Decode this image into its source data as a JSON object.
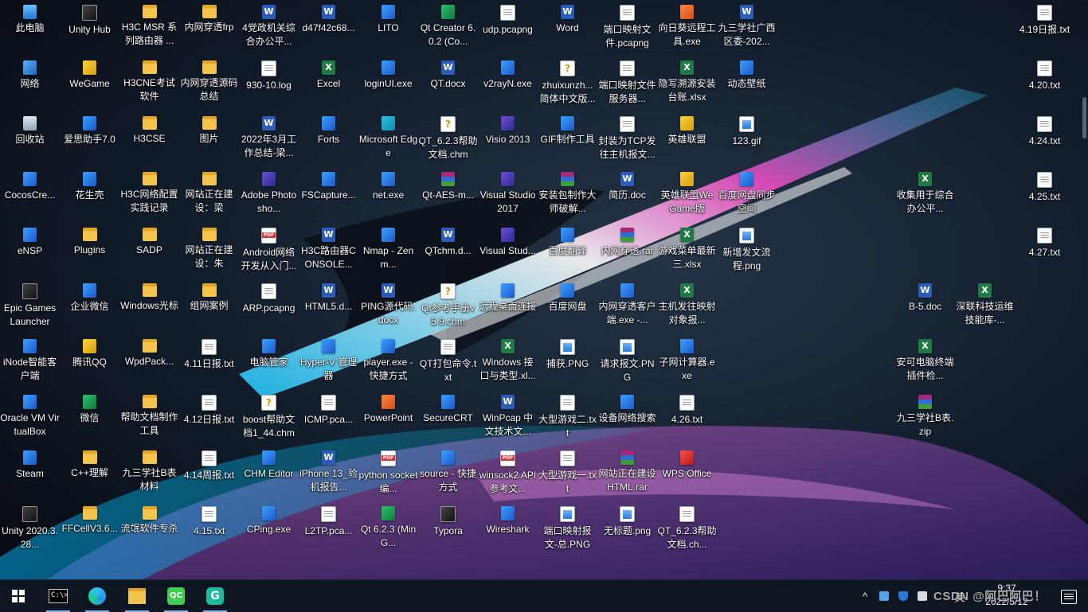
{
  "desktop": {
    "icons": [
      {
        "label": "此电脑",
        "icon": "pc-icon"
      },
      {
        "label": "Unity Hub",
        "icon": "unity-hub-icon"
      },
      {
        "label": "H3C MSR 系列路由器 ...",
        "icon": "folder-icon"
      },
      {
        "label": "内网穿透frp",
        "icon": "folder-icon"
      },
      {
        "label": "4党政机关综合办公平...",
        "icon": "word-icon"
      },
      {
        "label": "d47f42c68...",
        "icon": "word-icon"
      },
      {
        "label": "LITO",
        "icon": "app-icon"
      },
      {
        "label": "Qt Creator 6.0.2 (Co...",
        "icon": "qt-creator-icon"
      },
      {
        "label": "udp.pcapng",
        "icon": "document-icon"
      },
      {
        "label": "Word",
        "icon": "word-icon"
      },
      {
        "label": "端口映射文件.pcapng",
        "icon": "document-icon"
      },
      {
        "label": "向日葵远程工具.exe",
        "icon": "sunflower-icon"
      },
      {
        "label": "九三学社广西区委-202...",
        "icon": "word-icon"
      },
      {
        "label": "4.19日报.txt",
        "icon": "text-file-icon"
      },
      {
        "label": "网络",
        "icon": "network-icon"
      },
      {
        "label": "WeGame",
        "icon": "wegame-icon"
      },
      {
        "label": "H3CNE考试软件",
        "icon": "folder-icon"
      },
      {
        "label": "内网穿透源码总结",
        "icon": "folder-icon"
      },
      {
        "label": "930-10.log",
        "icon": "text-file-icon"
      },
      {
        "label": "Excel",
        "icon": "excel-icon"
      },
      {
        "label": "loginUI.exe",
        "icon": "exe-icon"
      },
      {
        "label": "QT.docx",
        "icon": "word-icon"
      },
      {
        "label": "v2rayN.exe",
        "icon": "exe-icon"
      },
      {
        "label": "zhuixunzh... 简体中文版...",
        "icon": "chm-icon"
      },
      {
        "label": "端口映射文件服务器...",
        "icon": "document-icon"
      },
      {
        "label": "隐写溯源安装台账.xlsx",
        "icon": "excel-icon"
      },
      {
        "label": "动态壁纸",
        "icon": "app-icon"
      },
      {
        "label": "4.20.txt",
        "icon": "text-file-icon"
      },
      {
        "label": "回收站",
        "icon": "recycle-bin-icon"
      },
      {
        "label": "爱思助手7.0",
        "icon": "app-icon"
      },
      {
        "label": "H3CSE",
        "icon": "folder-icon"
      },
      {
        "label": "图片",
        "icon": "folder-icon"
      },
      {
        "label": "2022年3月工作总结-梁...",
        "icon": "word-icon"
      },
      {
        "label": "Forts",
        "icon": "app-icon"
      },
      {
        "label": "Microsoft Edge",
        "icon": "edge-icon"
      },
      {
        "label": "QT_6.2.3帮助文档.chm",
        "icon": "chm-icon"
      },
      {
        "label": "Visio 2013",
        "icon": "visio-icon"
      },
      {
        "label": "GIF制作工具",
        "icon": "app-icon"
      },
      {
        "label": "封装为TCP发往主机报文...",
        "icon": "document-icon"
      },
      {
        "label": "英雄联盟",
        "icon": "game-icon"
      },
      {
        "label": "123.gif",
        "icon": "image-icon"
      },
      {
        "label": "4.24.txt",
        "icon": "text-file-icon"
      },
      {
        "label": "CocosCre...",
        "icon": "app-icon"
      },
      {
        "label": "花生壳",
        "icon": "app-icon"
      },
      {
        "label": "H3C网络配置实践记录",
        "icon": "folder-icon"
      },
      {
        "label": "网站正在建设：梁",
        "icon": "folder-icon"
      },
      {
        "label": "Adobe Photosho...",
        "icon": "photoshop-icon"
      },
      {
        "label": "FSCapture...",
        "icon": "app-icon"
      },
      {
        "label": "net.exe",
        "icon": "exe-icon"
      },
      {
        "label": "Qt-AES-m...",
        "icon": "rar-icon"
      },
      {
        "label": "Visual Studio 2017",
        "icon": "visual-studio-icon"
      },
      {
        "label": "安装包制作大师破解...",
        "icon": "rar-icon"
      },
      {
        "label": "简历.doc",
        "icon": "word-icon"
      },
      {
        "label": "英雄联盟WeGame版",
        "icon": "game-icon"
      },
      {
        "label": "百度网盘同步空间",
        "icon": "app-icon"
      },
      {
        "label": "收集用于综合办公平...",
        "icon": "excel-icon"
      },
      {
        "label": "4.25.txt",
        "icon": "text-file-icon"
      },
      {
        "label": "eNSP",
        "icon": "app-icon"
      },
      {
        "label": "Plugins",
        "icon": "folder-icon"
      },
      {
        "label": "SADP",
        "icon": "folder-icon"
      },
      {
        "label": "网站正在建设：朱",
        "icon": "folder-icon"
      },
      {
        "label": "Android网络开发从入门...",
        "icon": "pdf-icon"
      },
      {
        "label": "H3C路由器CONSOLE...",
        "icon": "word-icon"
      },
      {
        "label": "Nmap - Zenm...",
        "icon": "app-icon"
      },
      {
        "label": "QTchm.d...",
        "icon": "word-icon"
      },
      {
        "label": "Visual Stud...",
        "icon": "visual-studio-icon"
      },
      {
        "label": "百度翻译",
        "icon": "app-icon"
      },
      {
        "label": "内网穿透.rar",
        "icon": "rar-icon"
      },
      {
        "label": "游戏菜单最新三.xlsx",
        "icon": "excel-icon"
      },
      {
        "label": "新增发文流程.png",
        "icon": "image-icon"
      },
      {
        "label": "4.27.txt",
        "icon": "text-file-icon"
      },
      {
        "label": "Epic Games Launcher",
        "icon": "epic-icon"
      },
      {
        "label": "企业微信",
        "icon": "app-icon"
      },
      {
        "label": "Windows光标",
        "icon": "folder-icon"
      },
      {
        "label": "组网案例",
        "icon": "folder-icon"
      },
      {
        "label": "ARP.pcapng",
        "icon": "document-icon"
      },
      {
        "label": "HTML5.d...",
        "icon": "word-icon"
      },
      {
        "label": "PING源代码.docx",
        "icon": "word-icon"
      },
      {
        "label": "Qt参考手册v5.9.chm",
        "icon": "chm-icon"
      },
      {
        "label": "远程桌面连接",
        "icon": "app-icon"
      },
      {
        "label": "百度网盘",
        "icon": "app-icon"
      },
      {
        "label": "内网穿透客户端.exe -...",
        "icon": "exe-icon"
      },
      {
        "label": "主机发往映射对象报...",
        "icon": "excel-icon"
      },
      {
        "label": "B-5.doc",
        "icon": "word-icon"
      },
      {
        "label": "深联科技运维技能库-...",
        "icon": "excel-icon"
      },
      {
        "label": "iNode智能客户端",
        "icon": "app-icon"
      },
      {
        "label": "腾讯QQ",
        "icon": "qq-icon"
      },
      {
        "label": "WpdPack...",
        "icon": "folder-icon"
      },
      {
        "label": "4.11日报.txt",
        "icon": "text-file-icon"
      },
      {
        "label": "电脑管家",
        "icon": "app-icon"
      },
      {
        "label": "Hyper-V 管理器",
        "icon": "app-icon"
      },
      {
        "label": "player.exe - 快捷方式",
        "icon": "exe-icon"
      },
      {
        "label": "QT打包命令.txt",
        "icon": "text-file-icon"
      },
      {
        "label": "Windows 接口与类型.xl...",
        "icon": "excel-icon"
      },
      {
        "label": "捕获.PNG",
        "icon": "image-icon"
      },
      {
        "label": "请求报文.PNG",
        "icon": "image-icon"
      },
      {
        "label": "子网计算器.exe",
        "icon": "exe-icon"
      },
      {
        "label": "安可电脑终端插件检...",
        "icon": "excel-icon"
      },
      {
        "label": "Oracle VM VirtualBox",
        "icon": "virtualbox-icon"
      },
      {
        "label": "微信",
        "icon": "wechat-icon"
      },
      {
        "label": "帮助文档制作工具",
        "icon": "folder-icon"
      },
      {
        "label": "4.12日报.txt",
        "icon": "text-file-icon"
      },
      {
        "label": "boost帮助文档1_44.chm",
        "icon": "chm-icon"
      },
      {
        "label": "ICMP.pca...",
        "icon": "document-icon"
      },
      {
        "label": "PowerPoint",
        "icon": "powerpoint-icon"
      },
      {
        "label": "SecureCRT",
        "icon": "app-icon"
      },
      {
        "label": "WinPcap 中文技术文...",
        "icon": "word-icon"
      },
      {
        "label": "大型游戏二.txt",
        "icon": "text-file-icon"
      },
      {
        "label": "设备网络搜索",
        "icon": "app-icon"
      },
      {
        "label": "4.26.txt",
        "icon": "text-file-icon"
      },
      {
        "label": "九三学社B表.zip",
        "icon": "rar-icon"
      },
      {
        "label": "Steam",
        "icon": "steam-icon"
      },
      {
        "label": "C++理解",
        "icon": "folder-icon"
      },
      {
        "label": "九三学社B表材料",
        "icon": "folder-icon"
      },
      {
        "label": "4.14周报.txt",
        "icon": "text-file-icon"
      },
      {
        "label": "CHM Editor",
        "icon": "app-icon"
      },
      {
        "label": "iPhone 13_验机报告...",
        "icon": "word-icon"
      },
      {
        "label": "python socket编...",
        "icon": "pdf-icon"
      },
      {
        "label": "source - 快捷方式",
        "icon": "app-icon"
      },
      {
        "label": "winsock2 API参考文...",
        "icon": "pdf-icon"
      },
      {
        "label": "大型游戏一.txt",
        "icon": "text-file-icon"
      },
      {
        "label": "网站正在建设HTML.rar",
        "icon": "rar-icon"
      },
      {
        "label": "WPS Office",
        "icon": "wps-icon"
      },
      {
        "label": "Unity 2020.3.28...",
        "icon": "unity-icon"
      },
      {
        "label": "FFCellV3.6...",
        "icon": "folder-icon"
      },
      {
        "label": "流氓软件专杀",
        "icon": "folder-icon"
      },
      {
        "label": "4.15.txt",
        "icon": "text-file-icon"
      },
      {
        "label": "CPing.exe",
        "icon": "exe-icon"
      },
      {
        "label": "L2TP.pca...",
        "icon": "document-icon"
      },
      {
        "label": "Qt 6.2.3 (MinG...",
        "icon": "qt-creator-icon"
      },
      {
        "label": "Typora",
        "icon": "typora-icon"
      },
      {
        "label": "Wireshark",
        "icon": "wireshark-icon"
      },
      {
        "label": "端口映射报文-总.PNG",
        "icon": "image-icon"
      },
      {
        "label": "无标题.png",
        "icon": "image-icon"
      },
      {
        "label": "QT_6.2.3帮助文档.ch...",
        "icon": "text-file-icon"
      }
    ]
  },
  "taskbar": {
    "start": "start-icon",
    "pinned": [
      {
        "name": "terminal-icon",
        "text": "C:\\>"
      },
      {
        "name": "edge-icon",
        "text": ""
      },
      {
        "name": "file-explorer-icon",
        "text": ""
      },
      {
        "name": "qt-creator-icon",
        "text": ""
      },
      {
        "name": "grammarly-icon",
        "text": ""
      }
    ],
    "tray": {
      "ime": "英",
      "time": "9:37",
      "date": "2022/5/12"
    },
    "watermark": "CSDN @阿巴阿巴！"
  },
  "colors": {
    "taskbar_bg": "#0e1622",
    "folder": "#f5c44c",
    "accent": "#7bb3f0"
  }
}
